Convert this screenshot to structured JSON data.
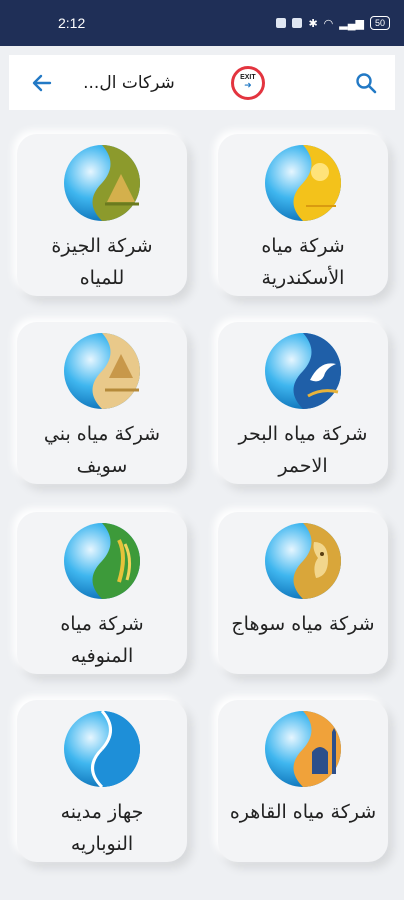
{
  "status_bar": {
    "time": "2:12",
    "battery": "50"
  },
  "app_bar": {
    "title": "شركات ال...",
    "exit_label": "EXIT",
    "back_icon": "arrow-left-icon",
    "search_icon": "search-icon"
  },
  "colors": {
    "status_bar": "#1f2f57",
    "accent": "#2279c5",
    "exit_ring": "#e3343f",
    "background": "#eef0f3"
  },
  "companies": [
    {
      "label": "شركة مياه الأسكندرية",
      "theme": "sun"
    },
    {
      "label": "شركة الجيزة للمياه",
      "theme": "pyramids"
    },
    {
      "label": "شركة مياه البحر الاحمر",
      "theme": "dolphin"
    },
    {
      "label": "شركة مياه بني سويف",
      "theme": "pyramid-gold"
    },
    {
      "label": "شركة مياه سوهاج",
      "theme": "pharaoh"
    },
    {
      "label": "شركة مياه المنوفيه",
      "theme": "wheat"
    },
    {
      "label": "شركة مياه القاهره",
      "theme": "mosque"
    },
    {
      "label": "جهاز مدينه النوباريه",
      "theme": "plain"
    }
  ]
}
